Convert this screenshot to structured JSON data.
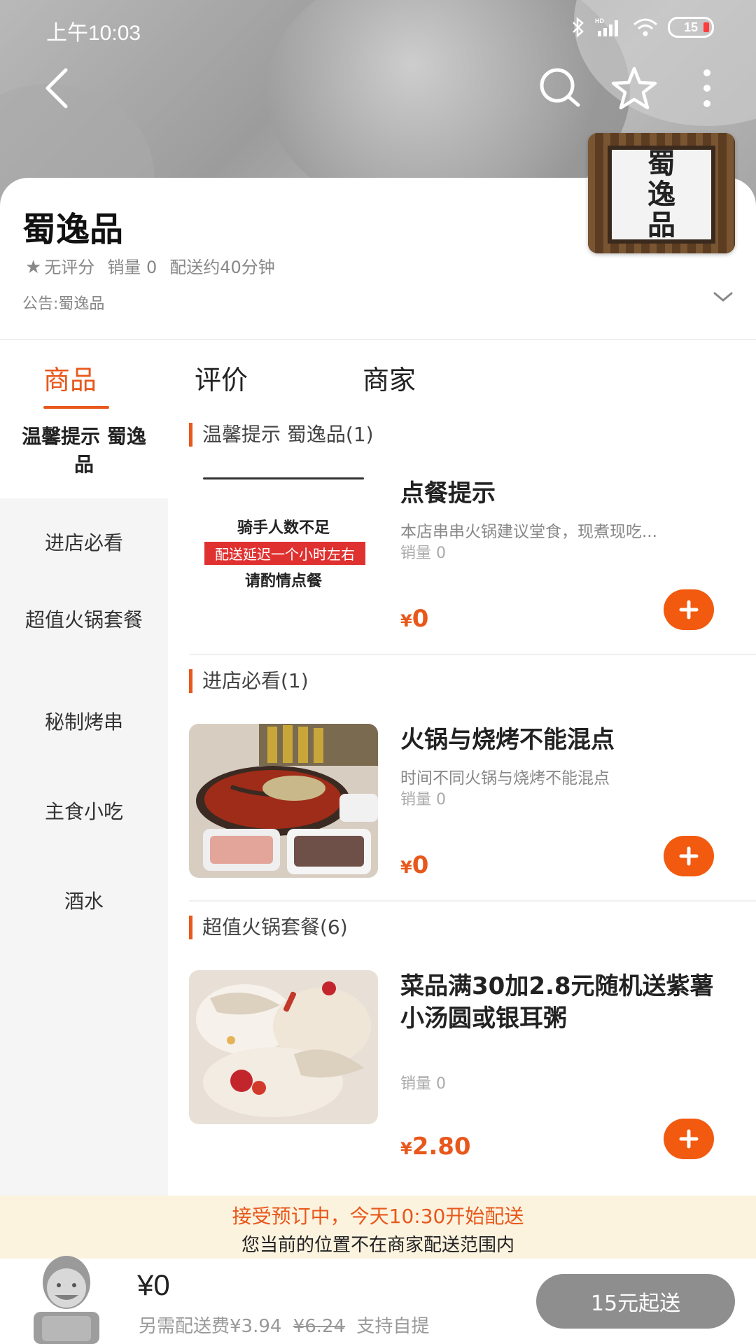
{
  "status_bar": {
    "time": "上午10:03",
    "battery": "15"
  },
  "store": {
    "name": "蜀逸品",
    "logo_text": [
      "蜀",
      "逸",
      "品"
    ],
    "rating": "无评分",
    "sales": "销量 0",
    "delivery_time": "配送约40分钟",
    "notice": "公告:蜀逸品"
  },
  "tabs": [
    "商品",
    "评价",
    "商家"
  ],
  "sidebar": [
    "温馨提示 蜀逸品",
    "进店必看",
    "超值火锅套餐",
    "秘制烤串",
    "主食小吃",
    "酒水"
  ],
  "sections": [
    {
      "title": "温馨提示 蜀逸品(1)",
      "product": {
        "name": "点餐提示",
        "desc": "本店串串火锅建议堂食，现煮现吃...",
        "sales": "销量 0",
        "price": "0",
        "image_text": [
          "骑手人数不足",
          "配送延迟一个小时左右",
          "请酌情点餐"
        ]
      }
    },
    {
      "title": "进店必看(1)",
      "product": {
        "name": "火锅与烧烤不能混点",
        "desc": "时间不同火锅与烧烤不能混点",
        "sales": "销量 0",
        "price": "0"
      }
    },
    {
      "title": "超值火锅套餐(6)",
      "product": {
        "name": "菜品满30加2.8元随机送紫薯小汤圆或银耳粥",
        "desc": "",
        "sales": "销量 0",
        "price": "2.80"
      }
    }
  ],
  "currency_symbol": "¥",
  "booking": {
    "line1": "接受预订中，今天10:30开始配送",
    "line2": "您当前的位置不在商家配送范围内"
  },
  "cart": {
    "total": "¥0",
    "fee_prefix": "另需配送费¥3.94",
    "fee_original": "¥6.24",
    "fee_suffix": "支持自提",
    "checkout": "15元起送"
  },
  "colors": {
    "accent": "#e8581c",
    "add_button": "#f25a10",
    "booking_bg": "#fcf3df"
  }
}
